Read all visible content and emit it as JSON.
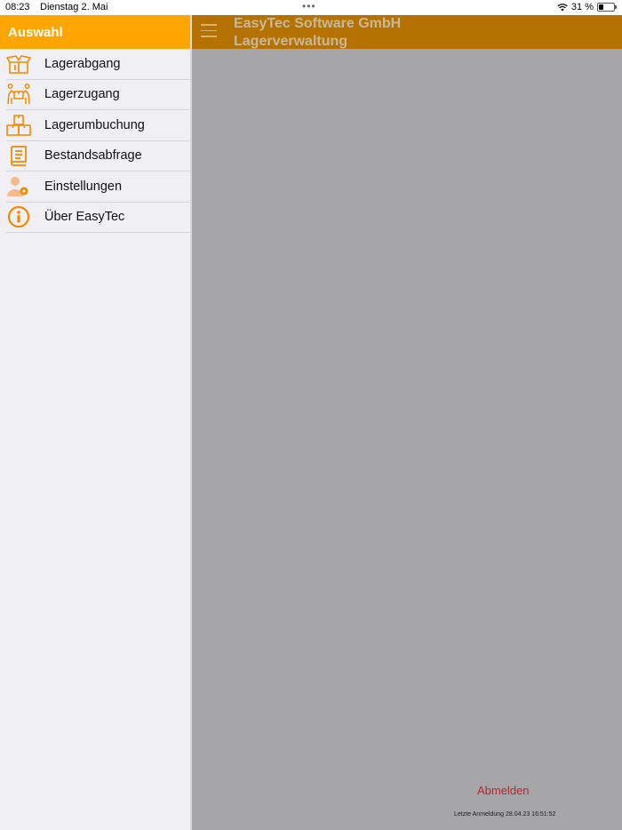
{
  "status": {
    "time": "08:23",
    "date": "Dienstag 2. Mai",
    "battery_percent": "31 %",
    "battery_level": 0.31
  },
  "sidebar": {
    "title": "Auswahl",
    "items": [
      {
        "label": "Lagerabgang",
        "icon": "open-box-icon"
      },
      {
        "label": "Lagerzugang",
        "icon": "people-carrying-box-icon"
      },
      {
        "label": "Lagerumbuchung",
        "icon": "stacked-boxes-icon"
      },
      {
        "label": "Bestandsabfrage",
        "icon": "book-list-icon"
      },
      {
        "label": "Einstellungen",
        "icon": "user-settings-icon"
      },
      {
        "label": "Über EasyTec",
        "icon": "info-icon"
      }
    ]
  },
  "header": {
    "company": "EasyTec Software GmbH",
    "module": "Lagerverwaltung"
  },
  "footer": {
    "logout_label": "Abmelden",
    "last_login": "Letzte Anmeldung 28.04.23 16:51:52"
  },
  "colors": {
    "accent": "#ffa500",
    "topbar": "#b67200",
    "overlay": "#a6a6a8",
    "logout": "#b4282e"
  }
}
